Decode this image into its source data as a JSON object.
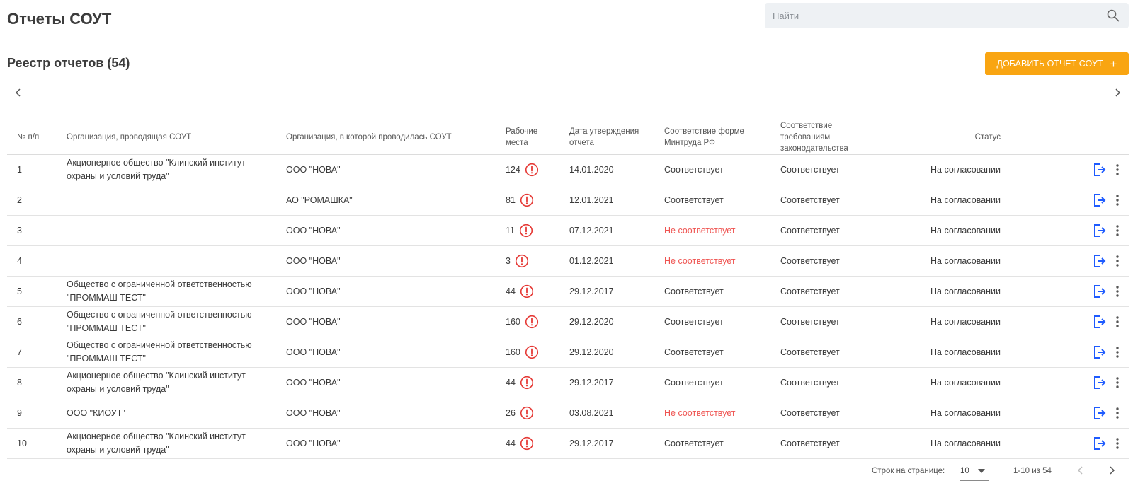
{
  "header": {
    "title": "Отчеты СОУТ",
    "search_placeholder": "Найти"
  },
  "registry": {
    "title": "Реестр отчетов (54)",
    "add_button_label": "ДОБАВИТЬ ОТЧЕТ СОУТ",
    "add_button_plus": "+"
  },
  "table": {
    "columns": {
      "num": "№ п/п",
      "org_conducting": "Организация, проводящая СОУТ",
      "org_conducted": "Организация, в которой проводилась СОУТ",
      "workplaces": "Рабочие места",
      "approval_date": "Дата утверждения отчета",
      "form_compliance": "Соответствие форме Минтруда РФ",
      "law_compliance": "Соответствие требованиям законодательства",
      "status": "Статус"
    },
    "rows": [
      {
        "num": "1",
        "org_conducting": "Акционерное общество \"Клинский институт охраны и условий труда\"",
        "org_conducted": "ООО \"НОВА\"",
        "workplaces": "124",
        "date": "14.01.2020",
        "form": "Соответствует",
        "law": "Соответствует",
        "status": "На согласовании"
      },
      {
        "num": "2",
        "org_conducting": "",
        "org_conducted": "АО \"РОМАШКА\"",
        "workplaces": "81",
        "date": "12.01.2021",
        "form": "Соответствует",
        "law": "Соответствует",
        "status": "На согласовании"
      },
      {
        "num": "3",
        "org_conducting": "",
        "org_conducted": "ООО \"НОВА\"",
        "workplaces": "11",
        "date": "07.12.2021",
        "form": "Не соответствует",
        "law": "Соответствует",
        "status": "На согласовании"
      },
      {
        "num": "4",
        "org_conducting": "",
        "org_conducted": "ООО \"НОВА\"",
        "workplaces": "3",
        "date": "01.12.2021",
        "form": "Не соответствует",
        "law": "Соответствует",
        "status": "На согласовании"
      },
      {
        "num": "5",
        "org_conducting": "Общество с ограниченной ответственностью \"ПРОММАШ ТЕСТ\"",
        "org_conducted": "ООО \"НОВА\"",
        "workplaces": "44",
        "date": "29.12.2017",
        "form": "Соответствует",
        "law": "Соответствует",
        "status": "На согласовании"
      },
      {
        "num": "6",
        "org_conducting": "Общество с ограниченной ответственностью \"ПРОММАШ ТЕСТ\"",
        "org_conducted": "ООО \"НОВА\"",
        "workplaces": "160",
        "date": "29.12.2020",
        "form": "Соответствует",
        "law": "Соответствует",
        "status": "На согласовании"
      },
      {
        "num": "7",
        "org_conducting": "Общество с ограниченной ответственностью \"ПРОММАШ ТЕСТ\"",
        "org_conducted": "ООО \"НОВА\"",
        "workplaces": "160",
        "date": "29.12.2020",
        "form": "Соответствует",
        "law": "Соответствует",
        "status": "На согласовании"
      },
      {
        "num": "8",
        "org_conducting": "Акционерное общество \"Клинский институт охраны и условий труда\"",
        "org_conducted": "ООО \"НОВА\"",
        "workplaces": "44",
        "date": "29.12.2017",
        "form": "Соответствует",
        "law": "Соответствует",
        "status": "На согласовании"
      },
      {
        "num": "9",
        "org_conducting": "ООО \"КИОУТ\"",
        "org_conducted": "ООО \"НОВА\"",
        "workplaces": "26",
        "date": "03.08.2021",
        "form": "Не соответствует",
        "law": "Соответствует",
        "status": "На согласовании"
      },
      {
        "num": "10",
        "org_conducting": "Акционерное общество \"Клинский институт охраны и условий труда\"",
        "org_conducted": "ООО \"НОВА\"",
        "workplaces": "44",
        "date": "29.12.2017",
        "form": "Соответствует",
        "law": "Соответствует",
        "status": "На согласовании"
      }
    ]
  },
  "pagination": {
    "rows_per_page_label": "Строк на странице:",
    "rows_per_page_value": "10",
    "range_label": "1-10 из 54"
  },
  "colors": {
    "accent": "#f9a512",
    "mismatch": "#ef5350",
    "warning_icon": "#e53935",
    "action_icon": "#1e5bff"
  },
  "icons": {
    "search": "search-icon",
    "warning": "exclamation-circle-icon",
    "export": "export-icon",
    "more": "more-vertical-icon",
    "prev": "chevron-left-icon",
    "next": "chevron-right-icon"
  }
}
